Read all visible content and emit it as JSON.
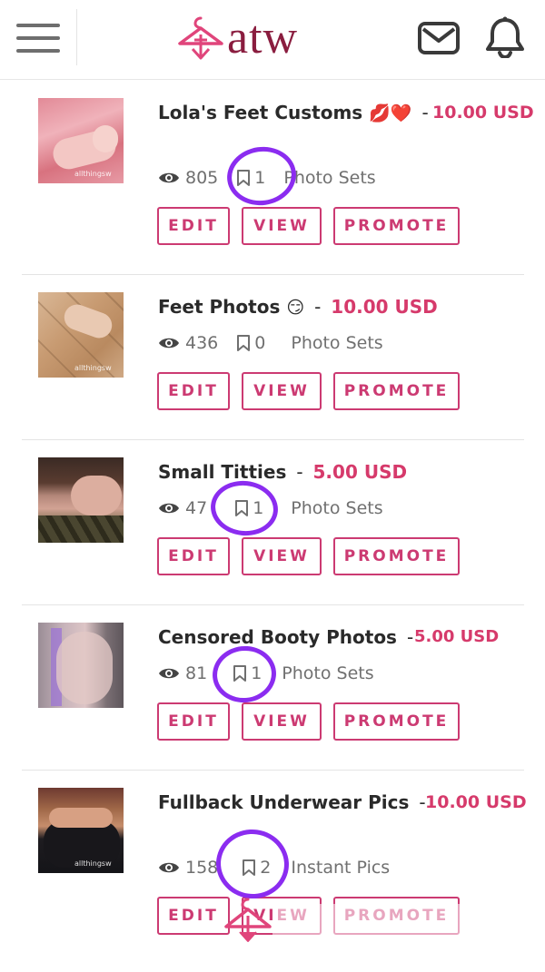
{
  "app": {
    "logo_text": "atw",
    "brand_color": "#8a1d3f",
    "accent_color": "#d63a6b",
    "annotation_color": "#8b2cf0"
  },
  "header": {
    "menu_icon": "hamburger-icon",
    "mail_icon": "mail-icon",
    "notification_icon": "bell-icon"
  },
  "buttons": {
    "edit": "EDIT",
    "view": "VIEW",
    "promote": "PROMOTE"
  },
  "listings": [
    {
      "title": "Lola's Feet Customs",
      "emoji": "💋❤️",
      "separator": "-",
      "price": "10.00 USD",
      "views": "805",
      "bookmarks": "1",
      "category": "Photo Sets",
      "watermark": "allthingsw"
    },
    {
      "title": "Feet Photos",
      "emoji": "😏",
      "separator": "-",
      "price": "10.00 USD",
      "views": "436",
      "bookmarks": "0",
      "category": "Photo Sets",
      "watermark": "allthingsw"
    },
    {
      "title": "Small Titties",
      "emoji": "",
      "separator": "-",
      "price": "5.00 USD",
      "views": "47",
      "bookmarks": "1",
      "category": "Photo Sets",
      "watermark": ""
    },
    {
      "title": "Censored Booty Photos",
      "emoji": "",
      "separator": "-",
      "price": "5.00 USD",
      "views": "81",
      "bookmarks": "1",
      "category": "Photo Sets",
      "watermark": ""
    },
    {
      "title": "Fullback Underwear Pics",
      "emoji": "",
      "separator": "-",
      "price": "10.00 USD",
      "views": "158",
      "bookmarks": "2",
      "category": "Instant Pics",
      "watermark": "allthingsw"
    }
  ]
}
